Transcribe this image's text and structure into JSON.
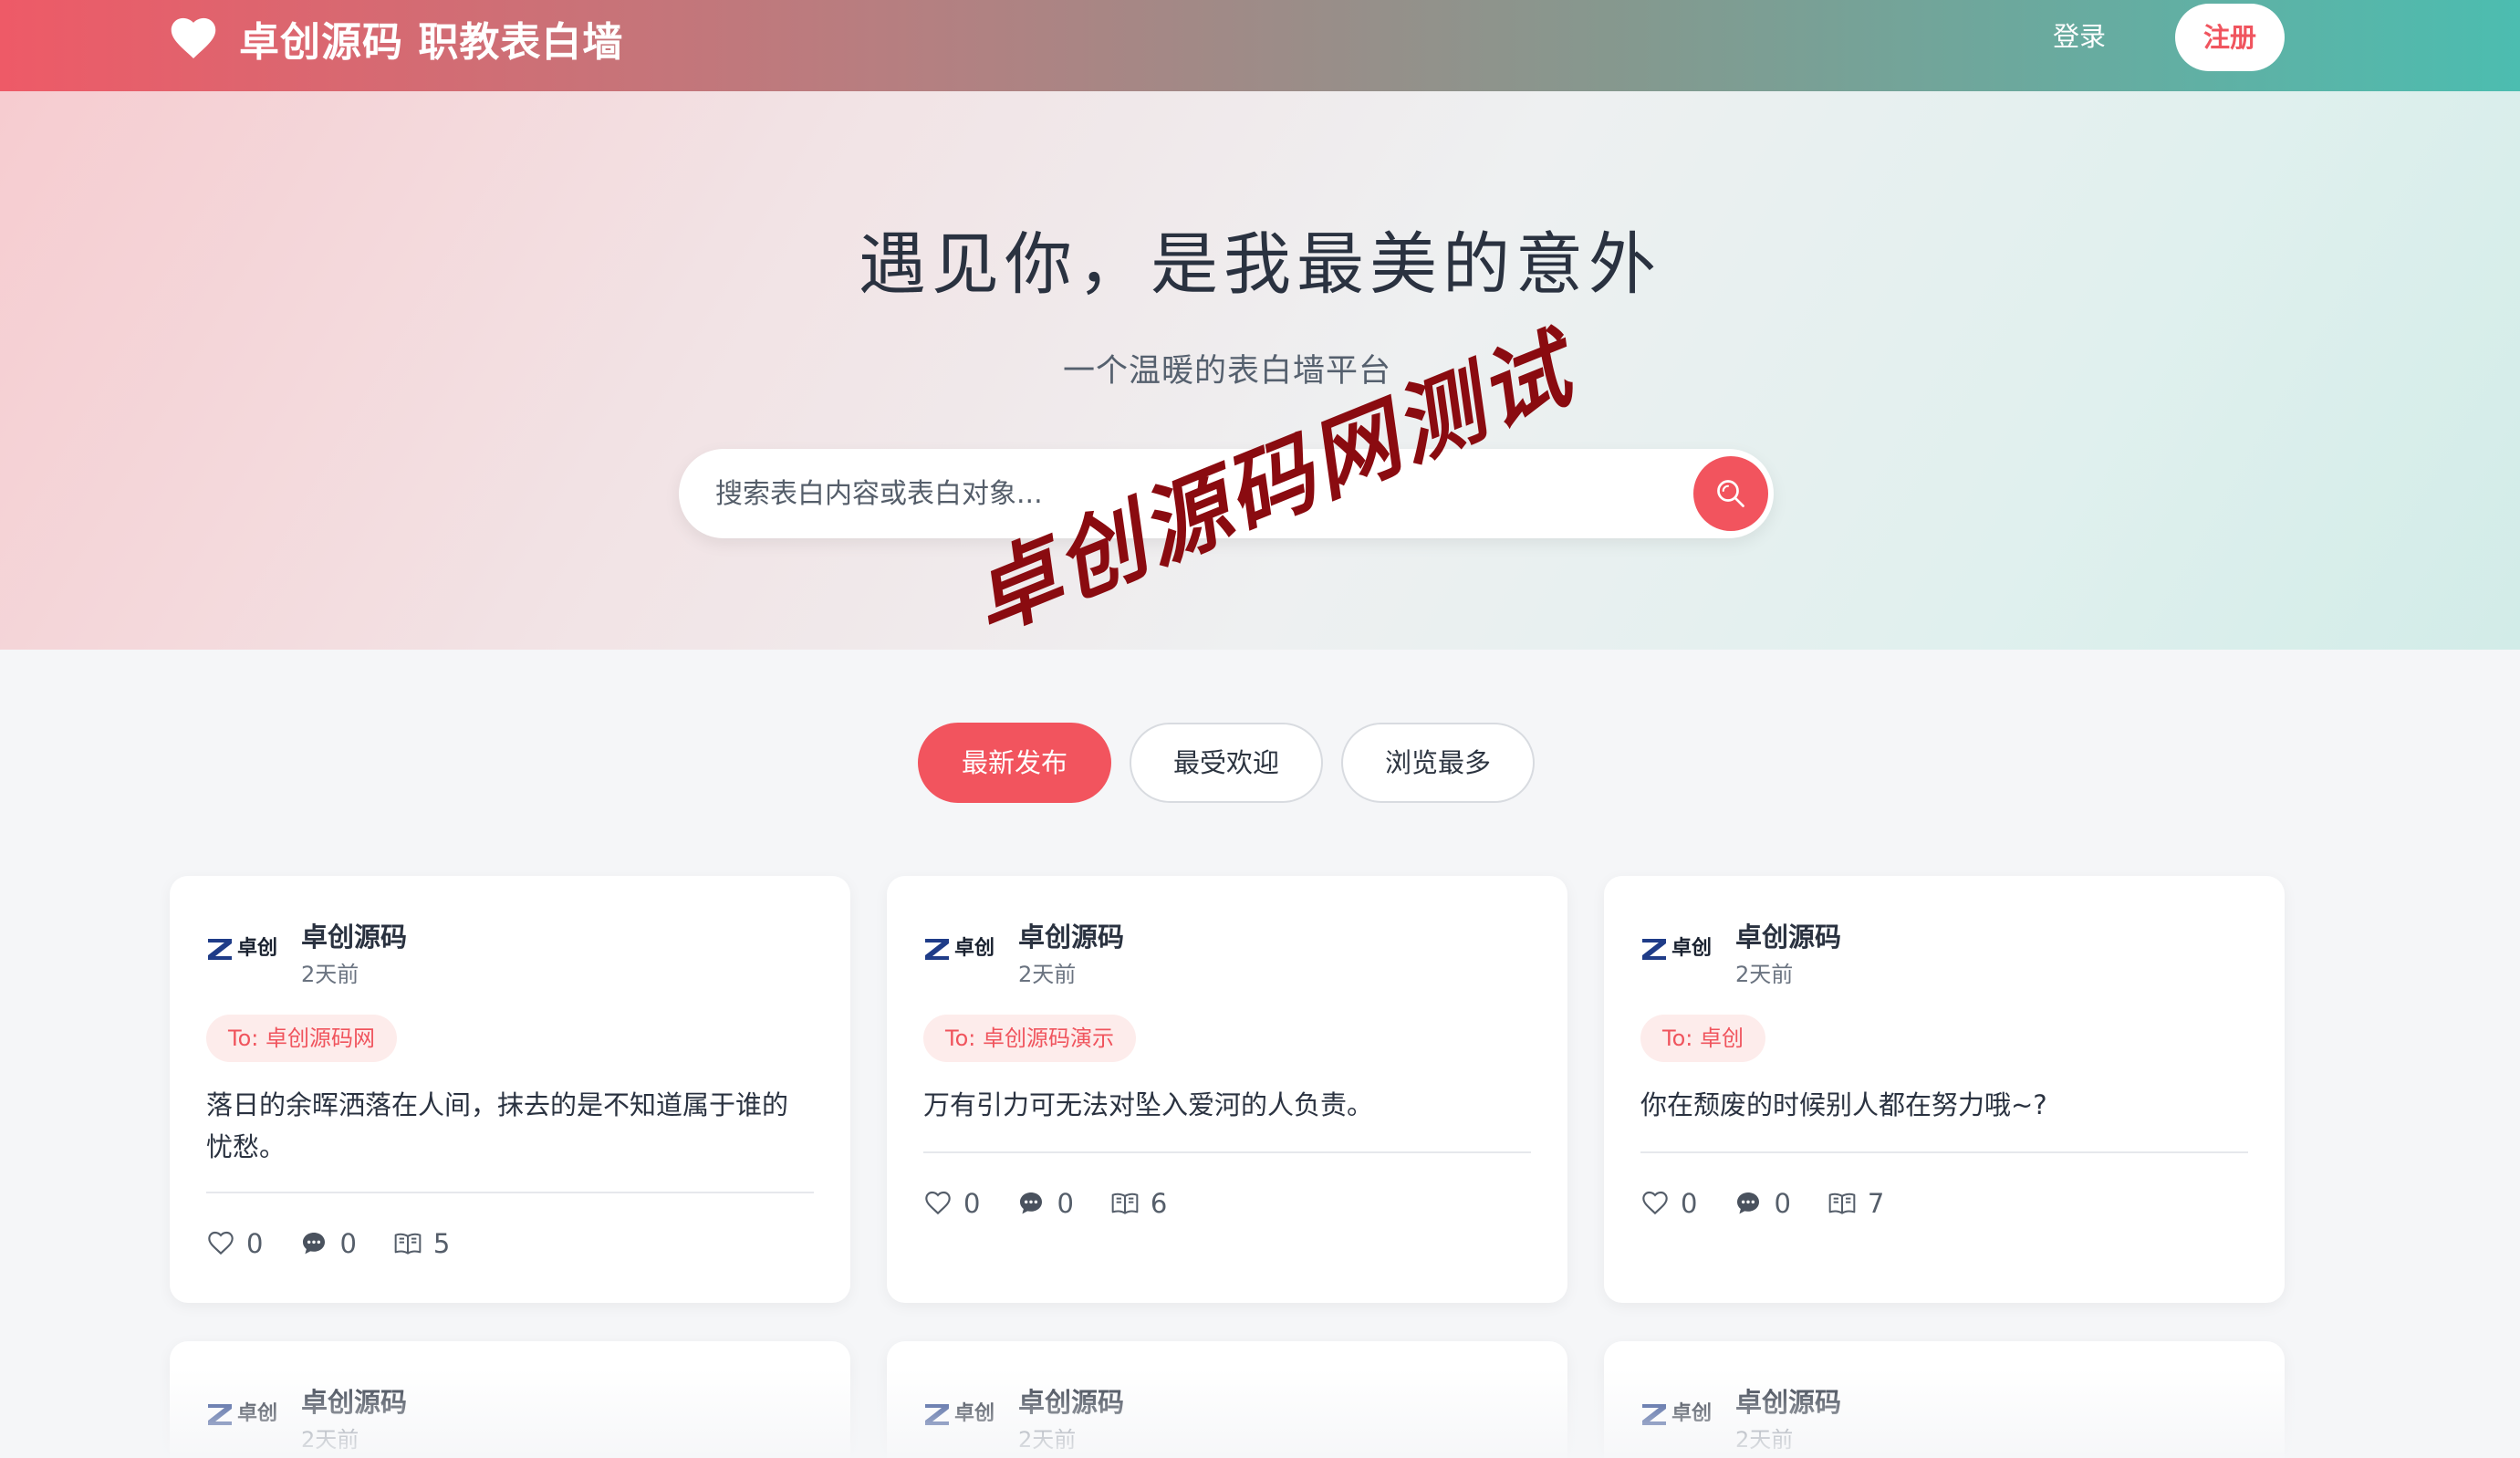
{
  "header": {
    "brand_title": "卓创源码 职教表白墙",
    "login_label": "登录",
    "register_label": "注册",
    "gradient_colors": [
      "#ee5a67",
      "#4cbdb0"
    ]
  },
  "hero": {
    "title": "遇见你，是我最美的意外",
    "subtitle": "一个温暖的表白墙平台",
    "search_placeholder": "搜索表白内容或表白对象...",
    "search_icon": "search-icon"
  },
  "watermark": "卓创源码网测试",
  "tabs": [
    {
      "label": "最新发布",
      "active": true
    },
    {
      "label": "最受欢迎",
      "active": false
    },
    {
      "label": "浏览最多",
      "active": false
    }
  ],
  "accent_color": "#f2545e",
  "avatar_logo": {
    "text": "卓创"
  },
  "posts": [
    {
      "author": "卓创源码",
      "time": "2天前",
      "to": "To: 卓创源码网",
      "content": "落日的余晖洒落在人间，抹去的是不知道属于谁的忧愁。",
      "likes": "0",
      "comments": "0",
      "views": "5"
    },
    {
      "author": "卓创源码",
      "time": "2天前",
      "to": "To: 卓创源码演示",
      "content": "万有引力可无法对坠入爱河的人负责。",
      "likes": "0",
      "comments": "0",
      "views": "6"
    },
    {
      "author": "卓创源码",
      "time": "2天前",
      "to": "To: 卓创",
      "content": "你在颓废的时候别人都在努力哦~?",
      "likes": "0",
      "comments": "0",
      "views": "7"
    },
    {
      "author": "卓创源码",
      "time": "2天前"
    },
    {
      "author": "卓创源码",
      "time": "2天前"
    },
    {
      "author": "卓创源码",
      "time": "2天前"
    }
  ]
}
